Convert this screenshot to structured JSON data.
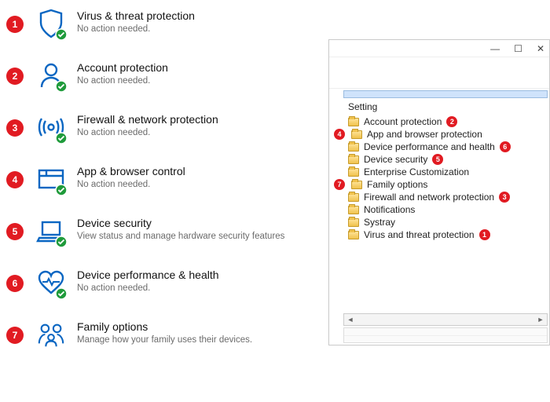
{
  "security": {
    "items": [
      {
        "num": "1",
        "title": "Virus & threat protection",
        "subtitle": "No action needed.",
        "check": true
      },
      {
        "num": "2",
        "title": "Account protection",
        "subtitle": "No action needed.",
        "check": true
      },
      {
        "num": "3",
        "title": "Firewall & network protection",
        "subtitle": "No action needed.",
        "check": true
      },
      {
        "num": "4",
        "title": "App & browser control",
        "subtitle": "No action needed.",
        "check": true
      },
      {
        "num": "5",
        "title": "Device security",
        "subtitle": "View status and manage hardware security features",
        "check": true
      },
      {
        "num": "6",
        "title": "Device performance & health",
        "subtitle": "No action needed.",
        "check": true
      },
      {
        "num": "7",
        "title": "Family options",
        "subtitle": "Manage how your family uses their devices.",
        "check": false
      }
    ]
  },
  "gpedit": {
    "header": "Setting",
    "items": [
      {
        "label": "Account protection",
        "badge": "2"
      },
      {
        "label": "App and browser protection",
        "badge": "4",
        "badge_before": true
      },
      {
        "label": "Device performance and health",
        "badge": "6"
      },
      {
        "label": "Device security",
        "badge": "5"
      },
      {
        "label": "Enterprise Customization",
        "badge": ""
      },
      {
        "label": "Family options",
        "badge": "7",
        "badge_before": true
      },
      {
        "label": "Firewall and network protection",
        "badge": "3"
      },
      {
        "label": "Notifications",
        "badge": ""
      },
      {
        "label": "Systray",
        "badge": ""
      },
      {
        "label": "Virus and threat protection",
        "badge": "1"
      }
    ],
    "window_controls": {
      "min": "—",
      "max": "☐",
      "close": "✕"
    }
  },
  "colors": {
    "accent": "#0a66c2",
    "green": "#1f9b3b",
    "red": "#e11b22"
  }
}
